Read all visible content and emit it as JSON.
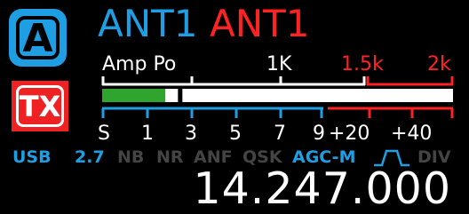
{
  "colors": {
    "rx_blue": "#1e9fe3",
    "tx_red": "#ff2222",
    "dim_gray": "#444444",
    "meter_green": "#2fa52f",
    "badge_red": "#ee2222"
  },
  "badges": {
    "antenna_letter": "A",
    "tx_label": "TX"
  },
  "antennas": {
    "rx": "ANT1",
    "tx": "ANT1"
  },
  "meter": {
    "top_labels": {
      "amp_po": "Amp Po",
      "one_k": "1K",
      "one_five_k": "1.5k",
      "two_k": "2k"
    },
    "scale_labels": [
      "S",
      "1",
      "3",
      "5",
      "7",
      "9",
      "+20",
      "+40"
    ],
    "signal_fraction": 0.3,
    "peak_fraction": 0.36
  },
  "status": {
    "mode": "USB",
    "bandwidth": "2.7",
    "nb": "NB",
    "nr": "NR",
    "anf": "ANF",
    "qsk": "QSK",
    "agc": "AGC-M",
    "filter_icon": "filter-shape-icon",
    "div": "DIV"
  },
  "frequency": "14.247.000"
}
